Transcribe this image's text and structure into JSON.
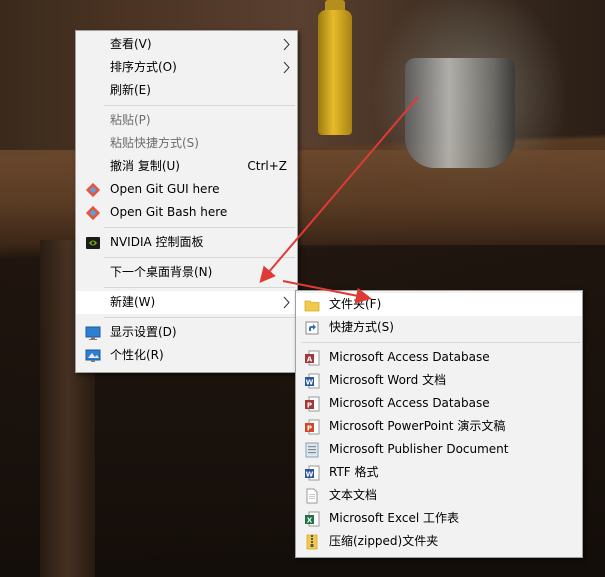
{
  "context_menu": {
    "items": [
      {
        "label": "查看(V)"
      },
      {
        "label": "排序方式(O)"
      },
      {
        "label": "刷新(E)"
      },
      {
        "label": "粘贴(P)"
      },
      {
        "label": "粘贴快捷方式(S)"
      },
      {
        "label": "撤消 复制(U)",
        "shortcut": "Ctrl+Z"
      },
      {
        "label": "Open Git GUI here"
      },
      {
        "label": "Open Git Bash here"
      },
      {
        "label": "NVIDIA 控制面板"
      },
      {
        "label": "下一个桌面背景(N)"
      },
      {
        "label": "新建(W)"
      },
      {
        "label": "显示设置(D)"
      },
      {
        "label": "个性化(R)"
      }
    ]
  },
  "new_submenu": {
    "items": [
      {
        "label": "文件夹(F)"
      },
      {
        "label": "快捷方式(S)"
      },
      {
        "label": "Microsoft Access Database"
      },
      {
        "label": "Microsoft Word 文档"
      },
      {
        "label": "Microsoft Access Database"
      },
      {
        "label": "Microsoft PowerPoint 演示文稿"
      },
      {
        "label": "Microsoft Publisher Document"
      },
      {
        "label": "RTF 格式"
      },
      {
        "label": "文本文档"
      },
      {
        "label": "Microsoft Excel 工作表"
      },
      {
        "label": "压缩(zipped)文件夹"
      }
    ]
  },
  "colors": {
    "annotation_arrow": "#e03a36",
    "menu_bg": "#f2f2f2",
    "highlight_bg": "#ffffff"
  }
}
